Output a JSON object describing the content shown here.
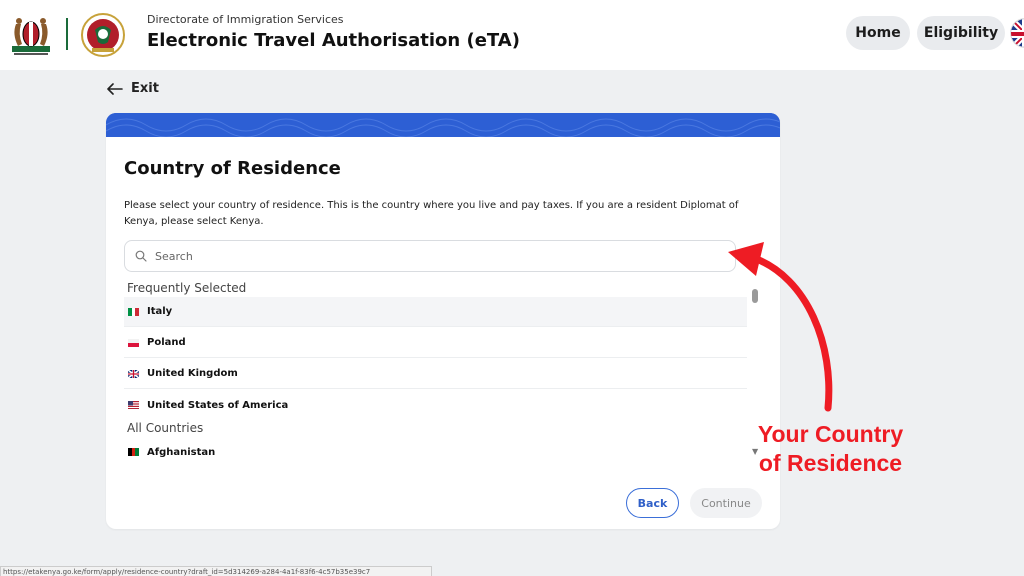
{
  "header": {
    "subtitle": "Directorate of Immigration Services",
    "title": "Electronic Travel Authorisation (eTA)",
    "nav": [
      {
        "label": "Home"
      },
      {
        "label": "Eligibility"
      }
    ]
  },
  "exit_label": "Exit",
  "card": {
    "title": "Country of Residence",
    "description": "Please select your country of residence. This is the country where you live and pay taxes. If you are a resident Diplomat of Kenya, please select Kenya.",
    "search_placeholder": "Search",
    "frequent_label": "Frequently Selected",
    "frequent": [
      {
        "name": "Italy"
      },
      {
        "name": "Poland"
      },
      {
        "name": "United Kingdom"
      },
      {
        "name": "United States of America"
      }
    ],
    "all_label": "All Countries",
    "all": [
      {
        "name": "Afghanistan"
      }
    ],
    "back_label": "Back",
    "continue_label": "Continue"
  },
  "annotation": {
    "line1": "Your Country",
    "line2": "of Residence",
    "color": "#ee1c24"
  },
  "colors": {
    "accent": "#2d5fd4",
    "annotation": "#ee1c24"
  },
  "status_bar_text": "https://etakenya.go.ke/form/apply/residence-country?draft_id=5d314269-a284-4a1f-83f6-4c57b35e39c7"
}
